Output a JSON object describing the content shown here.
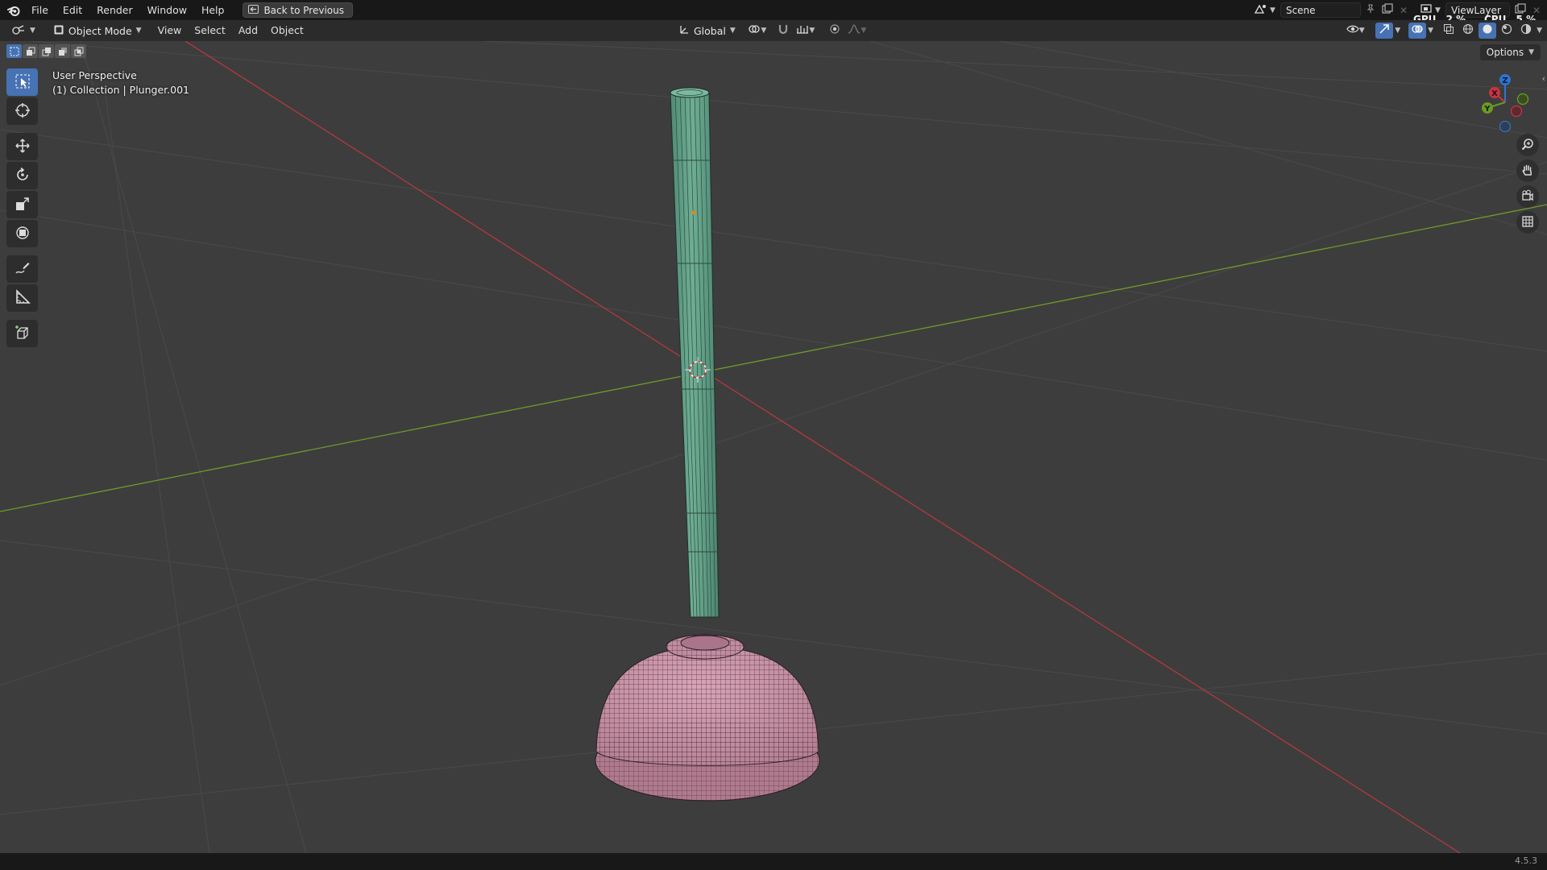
{
  "menu": {
    "items": [
      "File",
      "Edit",
      "Render",
      "Window",
      "Help"
    ],
    "back_button": "Back to Previous"
  },
  "workspace": {
    "scene_name": "Scene",
    "view_layer": "ViewLayer",
    "gpu_label": "GPU",
    "gpu_value": "2 %",
    "cpu_label": "CPU",
    "cpu_value": "5 %"
  },
  "header": {
    "mode": "Object Mode",
    "menus": [
      "View",
      "Select",
      "Add",
      "Object"
    ],
    "transform_orientation": "Global",
    "options": "Options"
  },
  "viewport": {
    "view_name": "User Perspective",
    "collection_info": "(1) Collection | Plunger.001",
    "gizmo_axes": {
      "x": "X",
      "y": "Y",
      "z": "Z"
    }
  },
  "tools": [
    "select-box",
    "cursor",
    "move",
    "rotate",
    "scale",
    "transform",
    "annotate",
    "measure",
    "add-cube"
  ],
  "status": {
    "version": "4.5.3"
  },
  "colors": {
    "handle_fill": "#5f9b85",
    "cup_fill": "#c58fa3",
    "x_axis": "#b5383f",
    "y_axis": "#6f9a2a",
    "active": "#4772b3"
  }
}
